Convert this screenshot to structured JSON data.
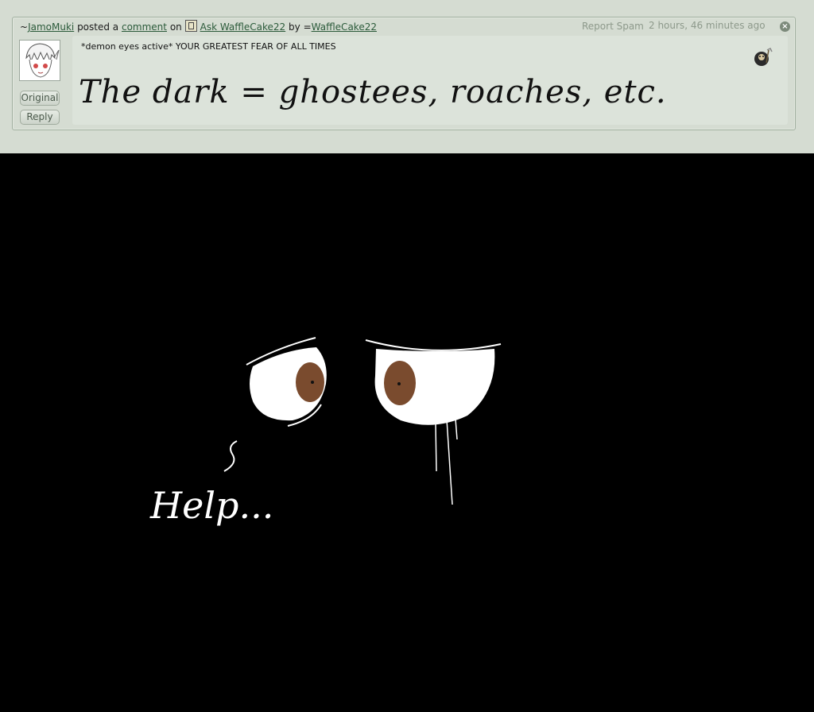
{
  "comment": {
    "author_prefix": "~",
    "author": "JamoMuki",
    "posted_a": "posted a",
    "comment_link": "comment",
    "on": "on",
    "deviation": "Ask WaffleCake22",
    "by": "by",
    "artist_prefix": "=",
    "artist": "WaffleCake22",
    "report_spam": "Report Spam",
    "timestamp": "2 hours, 46 minutes ago",
    "text": "*demon eyes active* YOUR GREATEST FEAR OF ALL TIMES",
    "close_symbol": "×"
  },
  "sidebar": {
    "original_label": "Original",
    "reply_label": "Reply"
  },
  "drawing": {
    "handwritten_answer": "The dark = ghostees, roaches, etc.",
    "help_text": "Help...",
    "icons": [
      "avatar-image",
      "comment-badge-icon",
      "gallery-icon",
      "close-icon"
    ],
    "colors": {
      "background": "#000000",
      "eye_white": "#ffffff",
      "iris": "#7a4b2e"
    }
  }
}
